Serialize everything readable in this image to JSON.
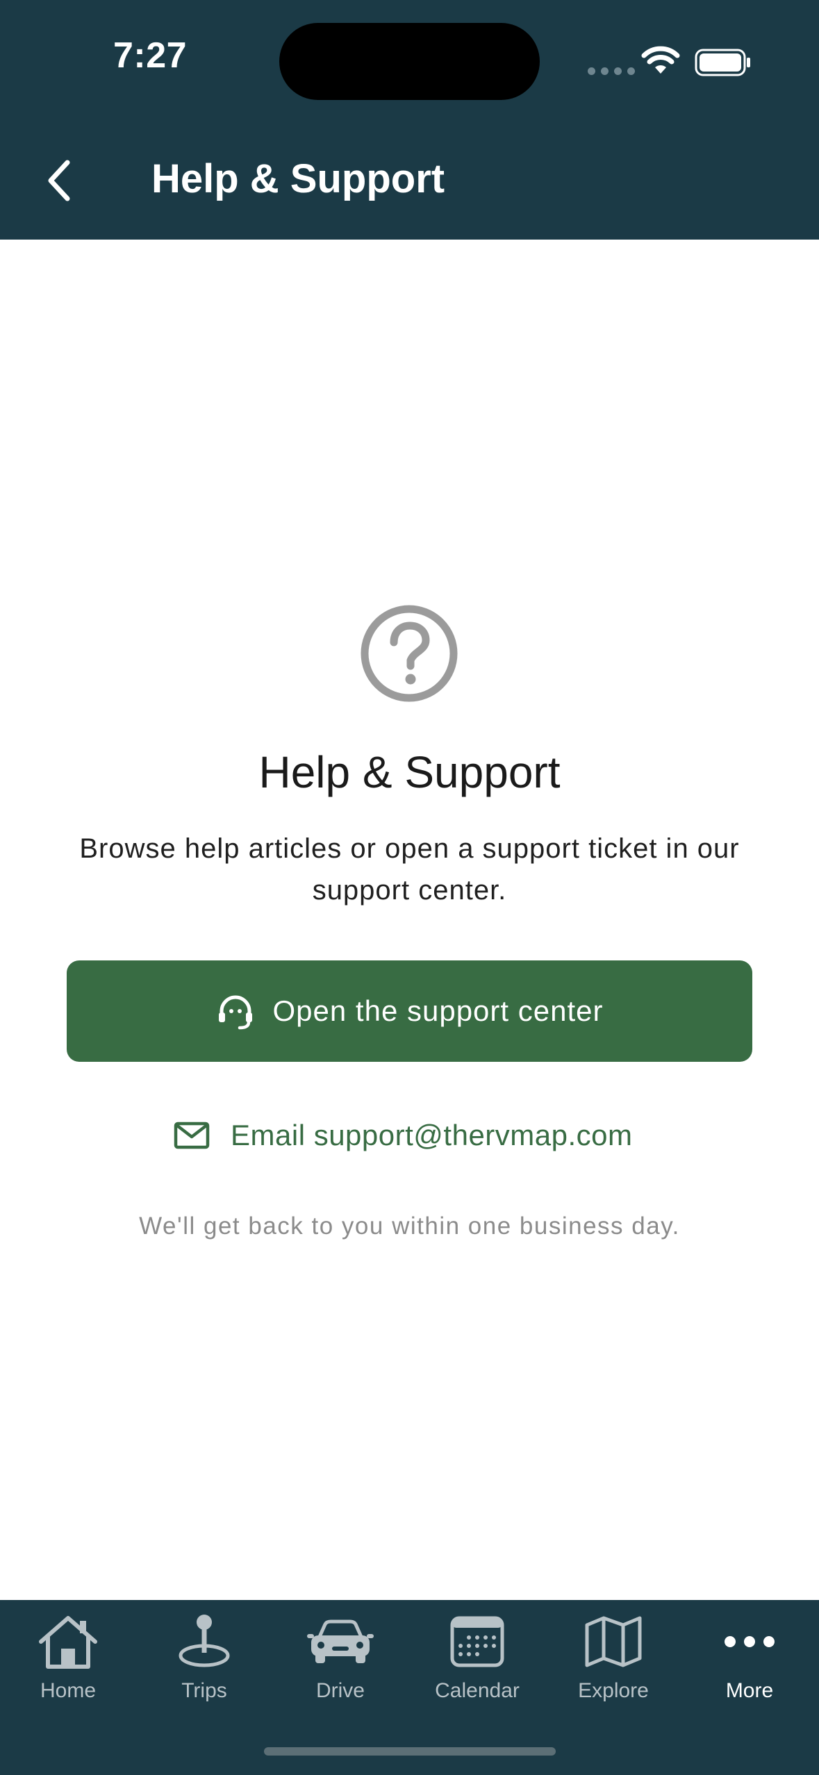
{
  "status_bar": {
    "time": "7:27"
  },
  "header": {
    "title": "Help & Support",
    "back_icon": "chevron-left-icon"
  },
  "main": {
    "icon": "question-circle-icon",
    "title": "Help & Support",
    "description": "Browse help articles or open a support ticket in our support center.",
    "primary_button": {
      "label": "Open the support center",
      "icon": "headset-icon"
    },
    "email_link": {
      "label": "Email support@thervmap.com",
      "icon": "mail-icon"
    },
    "note": "We'll get back to you within one business day."
  },
  "tabbar": {
    "items": [
      {
        "label": "Home",
        "icon": "home-icon",
        "active": false
      },
      {
        "label": "Trips",
        "icon": "map-pin-icon",
        "active": false
      },
      {
        "label": "Drive",
        "icon": "car-icon",
        "active": false
      },
      {
        "label": "Calendar",
        "icon": "calendar-icon",
        "active": false
      },
      {
        "label": "Explore",
        "icon": "map-icon",
        "active": false
      },
      {
        "label": "More",
        "icon": "more-icon",
        "active": true
      }
    ]
  },
  "colors": {
    "header_bg": "#1b3a46",
    "accent_green": "#386c43",
    "icon_gray": "#9b9b9b",
    "note_gray": "#8b8b8b",
    "tab_inactive": "#b8c2c7"
  }
}
